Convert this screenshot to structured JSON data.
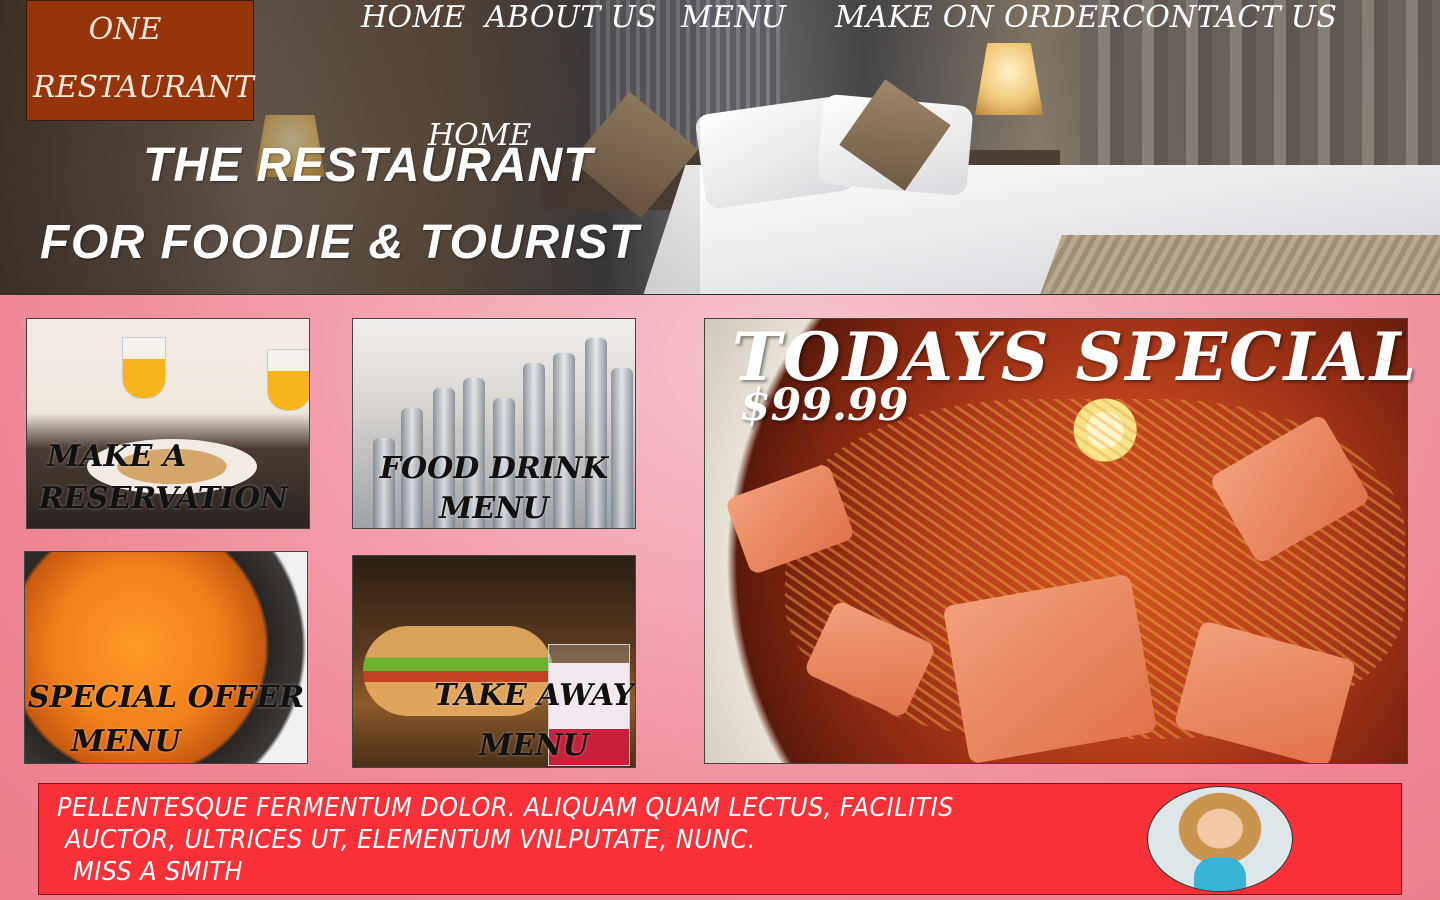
{
  "brand": {
    "line1": "ONE",
    "line2": "RESTAURANT"
  },
  "nav": {
    "items": [
      {
        "label": "HOME"
      },
      {
        "label": "ABOUT US"
      },
      {
        "label": "MENU"
      },
      {
        "label": "MAKE ON ORDER"
      },
      {
        "label": "CONTACT US"
      }
    ]
  },
  "hero": {
    "page_heading": "HOME",
    "title": "THE RESTAURANT",
    "subtitle": "FOR FOODIE & TOURIST"
  },
  "tiles": {
    "reservation": {
      "line1": "MAKE A",
      "line2": "RESERVATION"
    },
    "food_drink": {
      "line1": "FOOD DRINK",
      "line2": "MENU"
    },
    "special_offer": {
      "line1": "SPECIAL OFFER",
      "line2": "MENU"
    },
    "take_away": {
      "line1": "TAKE AWAY",
      "line2": "MENU"
    }
  },
  "todays_special": {
    "title": "TODAYS  SPECIAL",
    "price": "$99.99"
  },
  "testimonial": {
    "line1": "PELLENTESQUE FERMENTUM DOLOR. ALIQUAM QUAM LECTUS, FACILITIS",
    "line2": " AUCTOR, ULTRICES UT, ELEMENTUM VNLPUTATE, NUNC.",
    "author": "  MISS A SMITH"
  },
  "colors": {
    "brand_box": "#953509",
    "testimonial_bg": "#fb3139",
    "page_bg": "#f4a3b1"
  }
}
